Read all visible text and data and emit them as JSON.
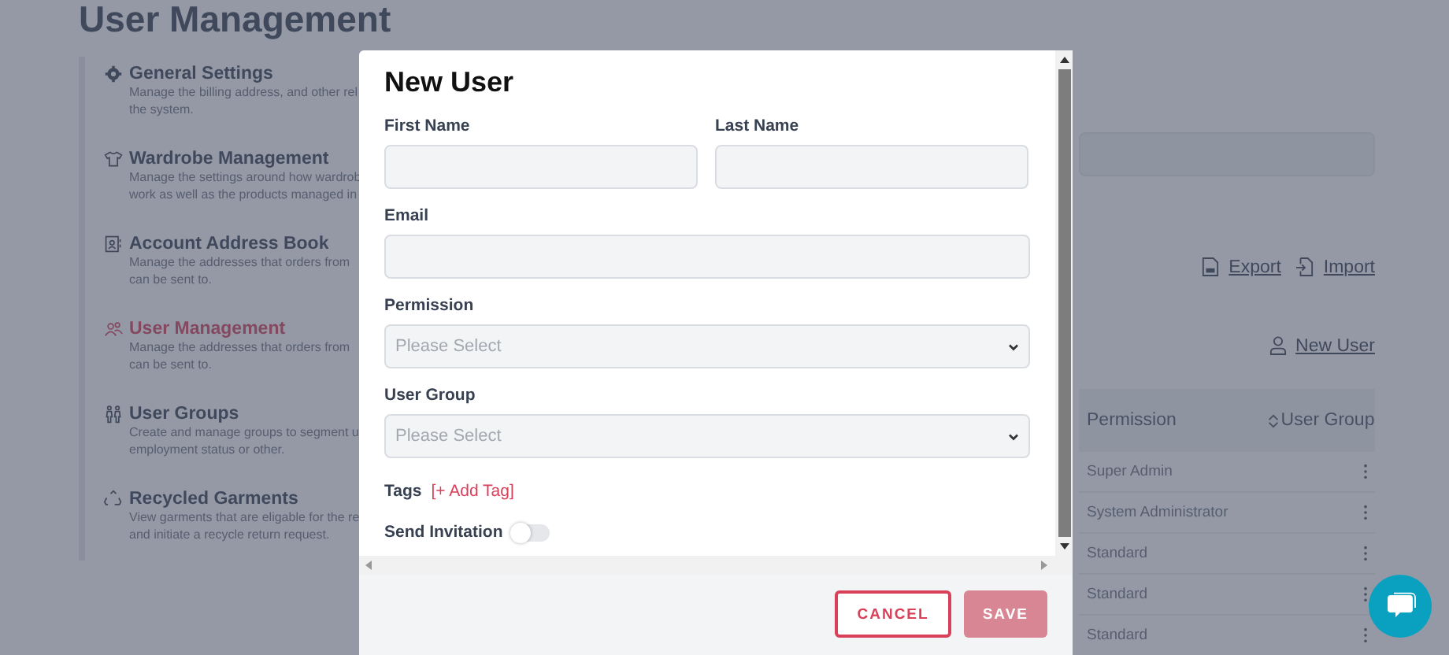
{
  "page": {
    "title": "User Management"
  },
  "sidebar": {
    "items": [
      {
        "kind": "gear",
        "title": "General Settings",
        "selected": false,
        "lines": [
          "Manage the billing address, and other rel",
          "the system."
        ]
      },
      {
        "kind": "shirt",
        "title": "Wardrobe Management",
        "selected": false,
        "lines": [
          "Manage the settings around how wardrob",
          "work as well as the products managed in"
        ]
      },
      {
        "kind": "contact",
        "title": "Account Address Book",
        "selected": false,
        "lines": [
          "Manage the addresses that orders from",
          "can be sent to."
        ]
      },
      {
        "kind": "users",
        "title": "User Management",
        "selected": true,
        "lines": [
          "Manage the addresses that orders from",
          "can be sent to."
        ]
      },
      {
        "kind": "groups",
        "title": "User Groups",
        "selected": false,
        "lines": [
          "Create and manage groups to segment u",
          "employment status or other."
        ]
      },
      {
        "kind": "recycle",
        "title": "Recycled Garments",
        "selected": false,
        "lines": [
          "View garments that are eligable for the re",
          "and initiate a recycle return request."
        ]
      }
    ]
  },
  "actions": {
    "export": "Export",
    "import": "Import",
    "new_user": "New User"
  },
  "table": {
    "columns": [
      "Permission",
      "User Group"
    ],
    "rows": [
      {
        "permission": "Super Admin"
      },
      {
        "permission": "System Administrator"
      },
      {
        "permission": "Standard"
      },
      {
        "permission": "Standard"
      },
      {
        "permission": "Standard"
      }
    ]
  },
  "dialog": {
    "title": "New User",
    "fields": [
      {
        "kind": "text",
        "label": "First Name",
        "half": true
      },
      {
        "kind": "text",
        "label": "Last Name",
        "half": true
      },
      {
        "kind": "text",
        "label": "Email",
        "half": false
      },
      {
        "kind": "select",
        "label": "Permission",
        "placeholder": "Please Select",
        "half": false
      },
      {
        "kind": "select",
        "label": "User Group",
        "placeholder": "Please Select",
        "half": false
      }
    ],
    "tags": {
      "label": "Tags",
      "add": "[+ Add Tag]"
    },
    "send_invitation": {
      "label": "Send Invitation",
      "on": false
    },
    "buttons": [
      {
        "kind": "cancel",
        "label": "CANCEL",
        "disabled": false
      },
      {
        "kind": "save",
        "label": "SAVE",
        "disabled": true
      }
    ]
  }
}
